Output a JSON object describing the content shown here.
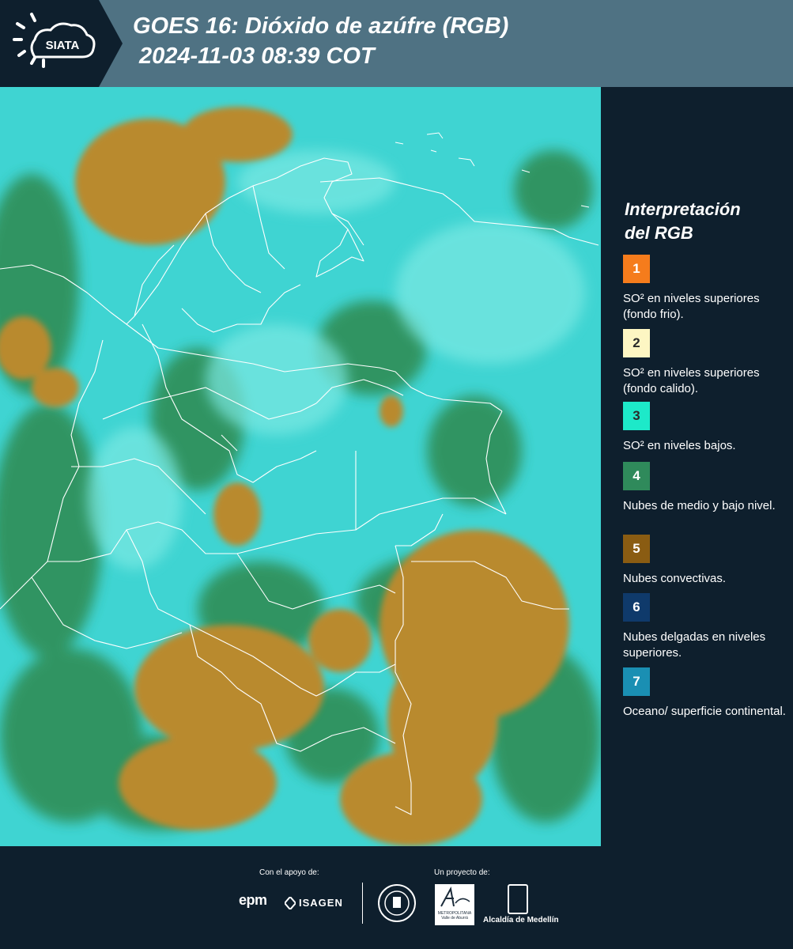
{
  "header": {
    "logo_text": "SIATA",
    "title_line1": "GOES 16: Dióxido de azúfre (RGB)",
    "title_line2": "2024-11-03 08:39 COT"
  },
  "legend": {
    "title_line1": "Interpretación",
    "title_line2": "del RGB",
    "items": [
      {
        "number": "1",
        "color": "#f57c1c",
        "label": "SO² en niveles superiores (fondo frio)."
      },
      {
        "number": "2",
        "color": "#fdf6c3",
        "label": "SO² en niveles superiores (fondo calido)."
      },
      {
        "number": "3",
        "color": "#1de9c9",
        "label": "SO² en niveles bajos."
      },
      {
        "number": "4",
        "color": "#2f8a5b",
        "label": "Nubes de medio y bajo nivel."
      },
      {
        "number": "5",
        "color": "#8a5c12",
        "label": "Nubes convectivas."
      },
      {
        "number": "6",
        "color": "#0f3a6b",
        "label": "Nubes delgadas en niveles superiores."
      },
      {
        "number": "7",
        "color": "#1a8fb3",
        "label": "Oceano/ superficie continental."
      }
    ]
  },
  "footer": {
    "support_label": "Con el apoyo de:",
    "project_label": "Un proyecto de:",
    "sponsor_1": "epm",
    "sponsor_2": "ISAGEN",
    "partner_1_text": "METROPOLITANA Valle de Aburrá",
    "partner_2": "Alcaldía de Medellín"
  },
  "colors": {
    "header_bg": "#4f7283",
    "panel_bg": "#0e1f2d",
    "map_cyan": "#3ad6d6",
    "map_green": "#2f8a5b",
    "map_convective": "#b98a2e"
  }
}
